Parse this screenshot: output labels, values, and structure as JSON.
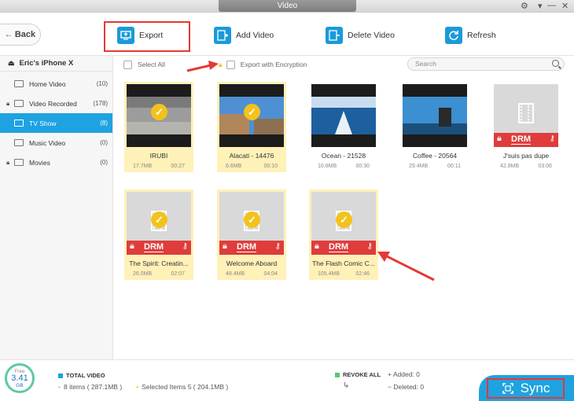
{
  "window": {
    "title": "Video"
  },
  "toolbar": {
    "back_label": "Back",
    "export_label": "Export",
    "add_video_label": "Add Video",
    "delete_video_label": "Delete Video",
    "refresh_label": "Refresh"
  },
  "sidebar": {
    "device": "Eric's iPhone X",
    "items": [
      {
        "label": "Home Video",
        "count": "(10)",
        "locked": false
      },
      {
        "label": "Video Recorded",
        "count": "(178)",
        "locked": true
      },
      {
        "label": "TV Show",
        "count": "(8)",
        "locked": false,
        "active": true
      },
      {
        "label": "Music Video",
        "count": "(0)",
        "locked": false
      },
      {
        "label": "Movies",
        "count": "(0)",
        "locked": true
      }
    ]
  },
  "filter": {
    "select_all": "Select All",
    "export_encryption": "Export with Encryption",
    "search_placeholder": "Search"
  },
  "videos": [
    {
      "title": "IRUBI",
      "size": "17.7MB",
      "duration": "00:27",
      "selected": true,
      "drm": false
    },
    {
      "title": "Alacati - 14476",
      "size": "6.6MB",
      "duration": "00:10",
      "selected": true,
      "drm": false
    },
    {
      "title": "Ocean - 21528",
      "size": "10.8MB",
      "duration": "00:30",
      "selected": false,
      "drm": false
    },
    {
      "title": "Coffee - 20564",
      "size": "29.4MB",
      "duration": "00:11",
      "selected": false,
      "drm": false
    },
    {
      "title": "J'suis pas dupe",
      "size": "42.8MB",
      "duration": "03:06",
      "selected": false,
      "drm": true
    },
    {
      "title": "The Spirit: Creatin...",
      "size": "26.0MB",
      "duration": "02:07",
      "selected": true,
      "drm": true
    },
    {
      "title": "Welcome Aboard",
      "size": "48.4MB",
      "duration": "04:04",
      "selected": true,
      "drm": true
    },
    {
      "title": "The Flash Comic C...",
      "size": "105.4MB",
      "duration": "02:46",
      "selected": true,
      "drm": true
    }
  ],
  "drm_label": "DRM",
  "footer": {
    "free_label": "Free",
    "free_value": "3.41",
    "free_unit": "GB",
    "total_video_label": "TOTAL VIDEO",
    "items_text": "8 items ( 287.1MB )",
    "selected_text": "Selected Items 5 ( 204.1MB )",
    "revoke_all": "REVOKE ALL",
    "added_text": "Added: 0",
    "deleted_text": "Deleted: 0",
    "sync_label": "Sync"
  },
  "colors": {
    "accent": "#1fa2e0",
    "selected_card": "#fff1b8",
    "check": "#f3c21c",
    "drm": "#df3c3c",
    "annotation": "#e53935"
  }
}
